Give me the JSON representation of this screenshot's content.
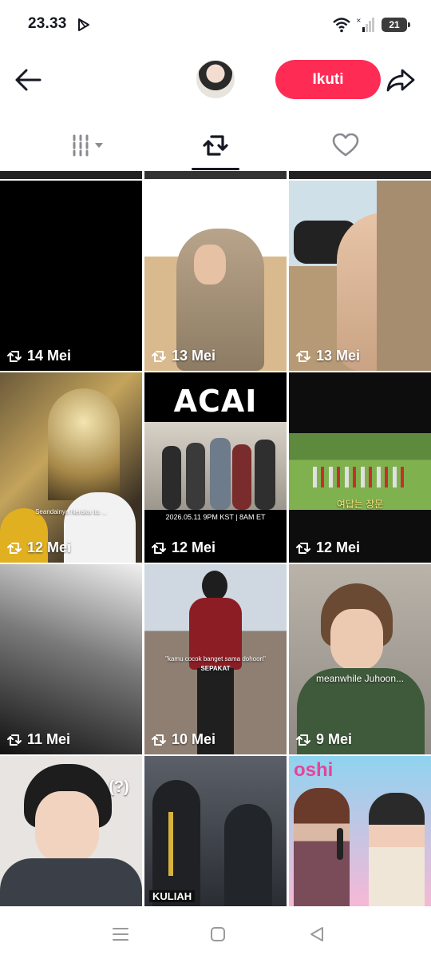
{
  "status_bar": {
    "time": "23.33",
    "battery": "21"
  },
  "header": {
    "follow_label": "Ikuti"
  },
  "tabs": [
    {
      "name": "videos",
      "icon": "grid-icon"
    },
    {
      "name": "reposts",
      "icon": "repost-icon",
      "active": true
    },
    {
      "name": "liked",
      "icon": "heart-icon"
    }
  ],
  "posts": [
    {
      "date": "14 Mei"
    },
    {
      "date": "13 Mei"
    },
    {
      "date": "13 Mei"
    },
    {
      "date": "12 Mei",
      "caption": "Seandainya Neraka itu ..."
    },
    {
      "date": "12 Mei",
      "title": "ACAI",
      "subtitle": "2026.05.11 9PM KST | 8AM ET"
    },
    {
      "date": "12 Mei",
      "caption": "여답는 장문"
    },
    {
      "date": "11 Mei"
    },
    {
      "date": "10 Mei",
      "caption": "\"kamu cocok banget sama dohoon\"",
      "caption2": "SEPAKAT"
    },
    {
      "date": "9 Mei",
      "caption": "meanwhile Juhoon..."
    },
    {
      "caption": "(?)"
    },
    {
      "caption": "KULIAH"
    },
    {
      "caption": "oshi"
    }
  ],
  "colors": {
    "accent": "#fe2c55",
    "text": "#161823"
  }
}
